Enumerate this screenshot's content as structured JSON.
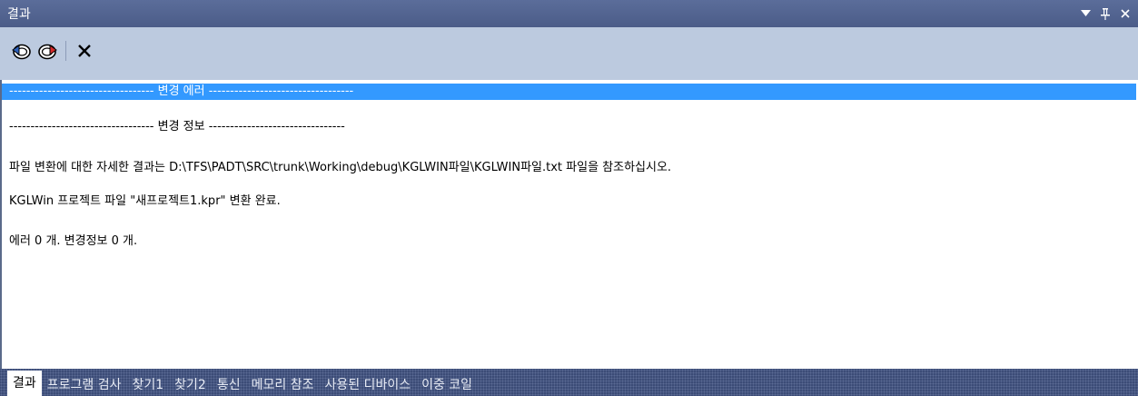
{
  "window": {
    "title": "결과"
  },
  "colors": {
    "titlebar": "#4b5c88",
    "toolbar": "#bccadf",
    "selection": "#3399ff",
    "tabbar": "#3c4c77"
  },
  "toolbar": {
    "buttons": [
      {
        "icon": "prev-message-icon"
      },
      {
        "icon": "next-message-icon"
      },
      {
        "icon": "clear-icon"
      }
    ]
  },
  "output": {
    "lines": [
      "---------------------------------- 변경 에러 ----------------------------------",
      "---------------------------------- 변경 정보 --------------------------------",
      "파일 변환에 대한 자세한 결과는 D:\\TFS\\PADT\\SRC\\trunk\\Working\\debug\\KGLWIN파일\\KGLWIN파일.txt 파일을 참조하십시오.",
      "KGLWin 프로젝트 파일 \"새프로젝트1.kpr\" 변환 완료.",
      "에러 0 개. 변경정보 0 개."
    ]
  },
  "tabs": [
    {
      "label": "결과",
      "active": true
    },
    {
      "label": "프로그램 검사"
    },
    {
      "label": "찾기1"
    },
    {
      "label": "찾기2"
    },
    {
      "label": "통신"
    },
    {
      "label": "메모리 참조"
    },
    {
      "label": "사용된 디바이스"
    },
    {
      "label": "이중 코일"
    }
  ]
}
